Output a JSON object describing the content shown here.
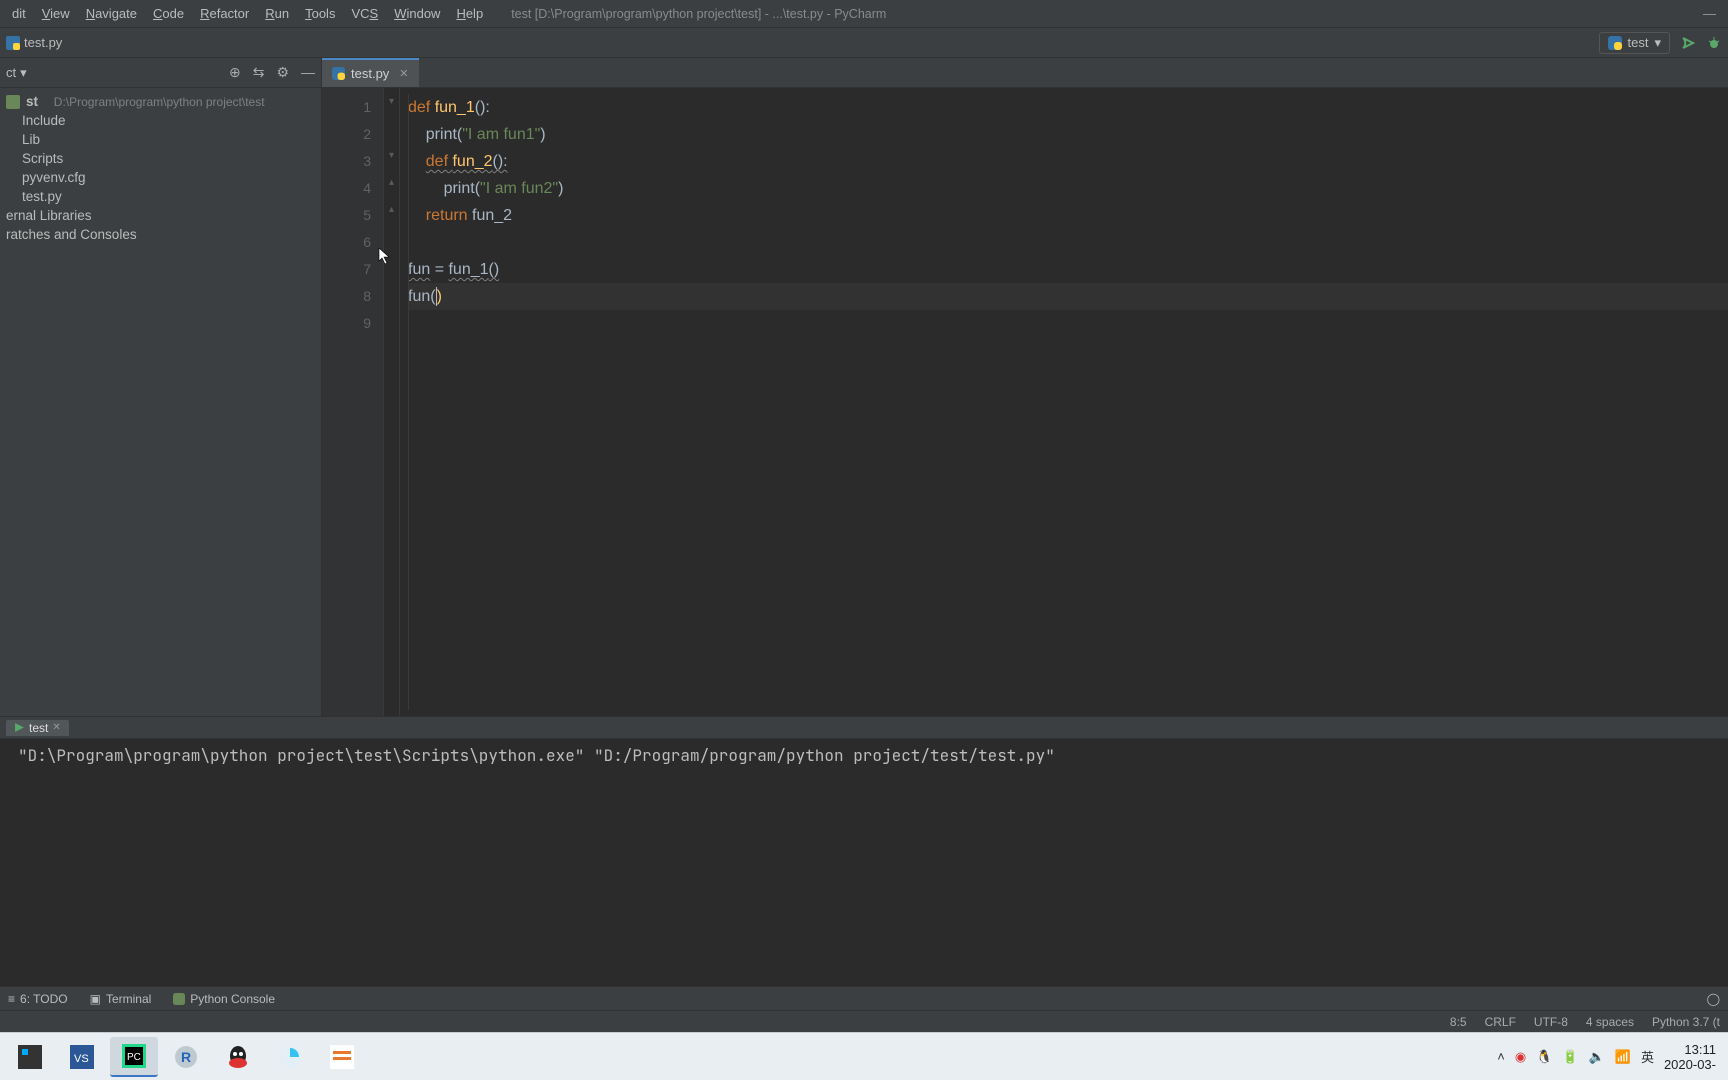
{
  "menu": {
    "items": [
      "dit",
      "View",
      "Navigate",
      "Code",
      "Refactor",
      "Run",
      "Tools",
      "VCS",
      "Window",
      "Help"
    ],
    "underline_idx": [
      -1,
      0,
      0,
      0,
      0,
      0,
      0,
      2,
      0,
      0
    ],
    "title": "test [D:\\Program\\program\\python project\\test] - ...\\test.py - PyCharm"
  },
  "breadcrumb": {
    "file": "test.py"
  },
  "run_config": {
    "name": "test"
  },
  "project": {
    "label": "ct",
    "root": {
      "name": "st",
      "path": "D:\\Program\\program\\python project\\test"
    },
    "children": [
      "Include",
      "Lib",
      "Scripts",
      "pyvenv.cfg",
      "test.py"
    ],
    "ext1": "ernal Libraries",
    "ext2": "ratches and Consoles"
  },
  "editor": {
    "tab_name": "test.py",
    "lines": [
      {
        "n": 1,
        "seg": [
          [
            "kw",
            "def "
          ],
          [
            "fn",
            "fun_1"
          ],
          [
            "pun",
            "():"
          ]
        ],
        "fold": "down"
      },
      {
        "n": 2,
        "seg": [
          [
            "pun",
            "    "
          ],
          [
            "id",
            "print"
          ],
          [
            "pun",
            "("
          ],
          [
            "str",
            "\"I am fun1\""
          ],
          [
            "pun",
            ")"
          ]
        ],
        "fold": ""
      },
      {
        "n": 3,
        "seg": [
          [
            "pun",
            "    "
          ],
          [
            "kw wavy",
            "def "
          ],
          [
            "fn wavy",
            "fun_2"
          ],
          [
            "pun wavy",
            "():"
          ]
        ],
        "fold": "down"
      },
      {
        "n": 4,
        "seg": [
          [
            "pun",
            "        "
          ],
          [
            "id",
            "print"
          ],
          [
            "pun",
            "("
          ],
          [
            "str",
            "\"I am fun2\""
          ],
          [
            "pun",
            ")"
          ]
        ],
        "fold": "up"
      },
      {
        "n": 5,
        "seg": [
          [
            "pun",
            "    "
          ],
          [
            "kw",
            "return "
          ],
          [
            "id",
            "fun_2"
          ]
        ],
        "fold": "up"
      },
      {
        "n": 6,
        "seg": [
          [
            "pun",
            ""
          ]
        ],
        "fold": ""
      },
      {
        "n": 7,
        "seg": [
          [
            "id wavy",
            "fun"
          ],
          [
            "pun",
            " = "
          ],
          [
            "id wavy",
            "fun_1"
          ],
          [
            "pun wavy",
            "()"
          ]
        ],
        "fold": ""
      },
      {
        "n": 8,
        "seg": [
          [
            "id",
            "fun"
          ],
          [
            "pun",
            "("
          ],
          [
            "caret",
            ""
          ],
          [
            "hl",
            ")"
          ]
        ],
        "fold": "",
        "active": true
      },
      {
        "n": 9,
        "seg": [
          [
            "pun",
            ""
          ]
        ],
        "fold": ""
      }
    ]
  },
  "run": {
    "tab": "test",
    "output": "\"D:\\Program\\program\\python project\\test\\Scripts\\python.exe\" \"D:/Program/program/python project/test/test.py\""
  },
  "toolstrip": {
    "t1": "6: TODO",
    "t2": "Terminal",
    "t3": "Python Console"
  },
  "status": {
    "pos": "8:5",
    "eol": "CRLF",
    "enc": "UTF-8",
    "indent": "4 spaces",
    "py": "Python 3.7 (t"
  },
  "tray": {
    "ime": "英",
    "time": "13:11",
    "date": "2020-03-"
  }
}
